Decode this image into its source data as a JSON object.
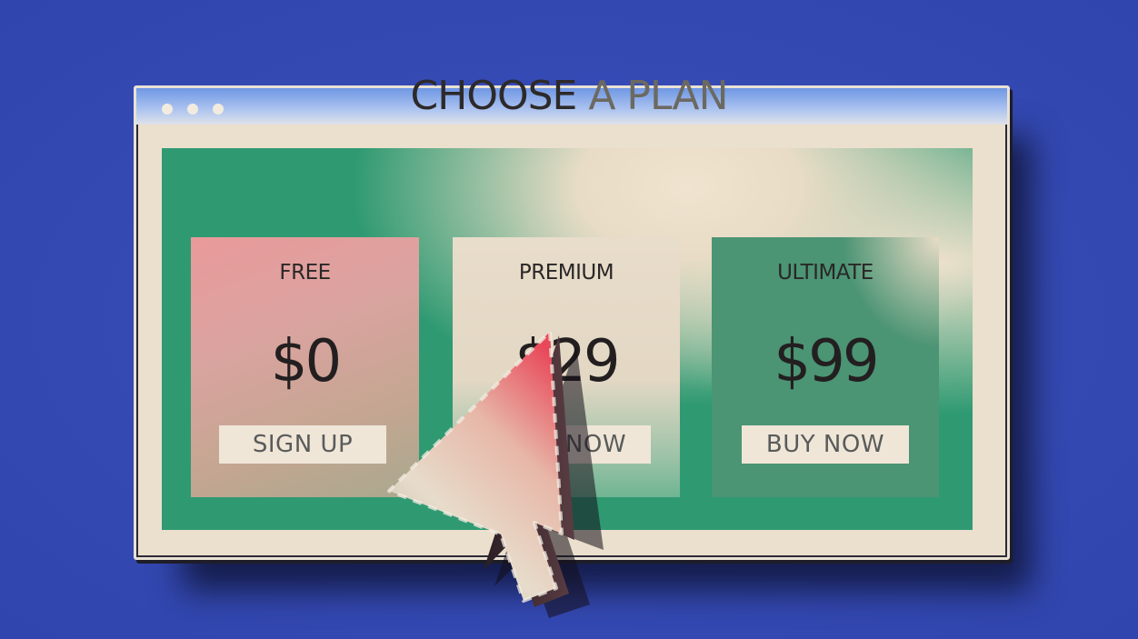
{
  "window": {
    "controls": [
      "dot",
      "dot",
      "dot"
    ],
    "background": "#ebdfcd",
    "titlebar_color": "#6f97e4"
  },
  "page": {
    "heading_dark": "CHOOSE",
    "heading_light": "A PLAN",
    "accent": "#2f9a72"
  },
  "plans": [
    {
      "name": "FREE",
      "price": "$0",
      "button": "SIGN UP",
      "color": "#e99a9a"
    },
    {
      "name": "PREMIUM",
      "price": "$29",
      "price_visible": "29",
      "button": "BUY NOW",
      "button_visible": "OW",
      "color": "#e8dcca"
    },
    {
      "name": "ULTIMATE",
      "price": "$99",
      "button": "BUY NOW",
      "color": "#4b9474"
    }
  ],
  "background_color": "#3349b8",
  "icons": {
    "cursor": "mouse-pointer-icon"
  }
}
